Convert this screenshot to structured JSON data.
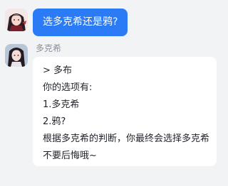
{
  "user_message": {
    "text": "选多克希还是鸦?"
  },
  "bot_message": {
    "sender_name": "多克希",
    "lines": [
      "> 多布",
      "你的选项有:",
      "1.多克希",
      "2.鸦?",
      "根据多克希的判断，你最终会选择多克希",
      "不要后悔哦~"
    ]
  },
  "colors": {
    "background": "#f2f3f5",
    "user_bubble": "#2b7bf6",
    "bot_bubble": "#ffffff",
    "name_text": "#8a8f99"
  },
  "icons": {
    "user_avatar": "anime-girl-avatar",
    "bot_avatar": "anime-girl-avatar"
  }
}
